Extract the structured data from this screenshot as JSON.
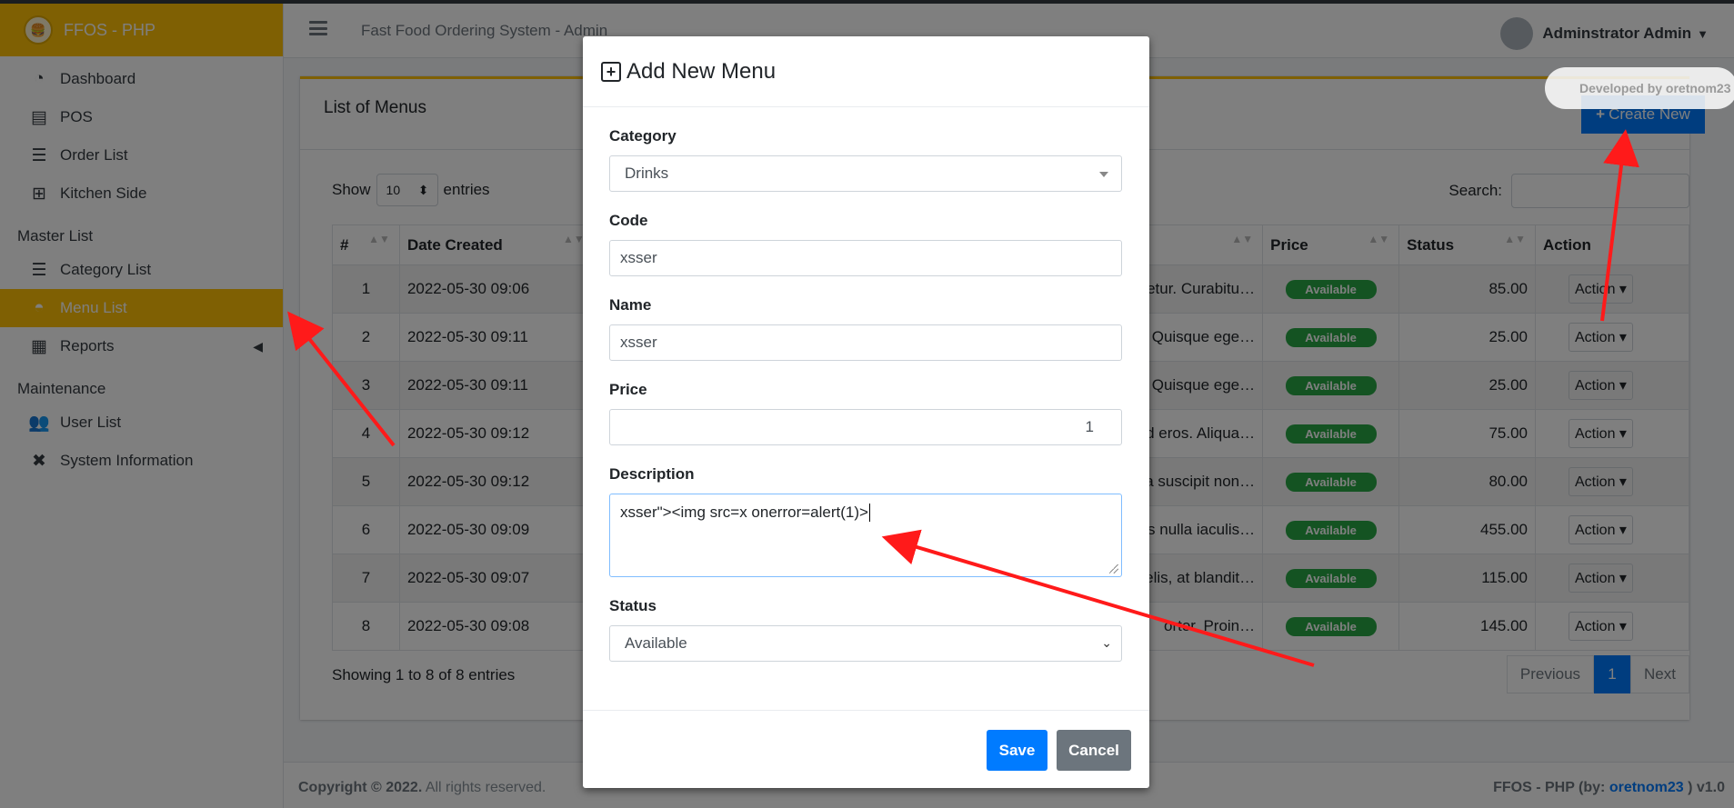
{
  "brand": {
    "name": "FFOS - PHP"
  },
  "sidebar": {
    "items": [
      {
        "label": "Dashboard",
        "icon": "tachometer-icon"
      },
      {
        "label": "POS",
        "icon": "cash-register-icon"
      },
      {
        "label": "Order List",
        "icon": "table-list-icon"
      },
      {
        "label": "Kitchen Side",
        "icon": "table-grid-icon"
      }
    ],
    "master_header": "Master List",
    "master_items": [
      {
        "label": "Category List",
        "icon": "table-list-icon"
      },
      {
        "label": "Menu List",
        "icon": "burger-icon",
        "active": true
      },
      {
        "label": "Reports",
        "icon": "file-icon"
      }
    ],
    "maintenance_header": "Maintenance",
    "maintenance_items": [
      {
        "label": "User List",
        "icon": "users-cog-icon"
      },
      {
        "label": "System Information",
        "icon": "tools-icon"
      }
    ]
  },
  "topbar": {
    "title": "Fast Food Ordering System - Admin",
    "user": "Adminstrator Admin"
  },
  "card": {
    "title": "List of Menus",
    "create_label": "Create New",
    "developer": "Developed by oretnom23",
    "show": "Show",
    "entries_value": "10",
    "entries": "entries",
    "search_label": "Search:",
    "showing": "Showing 1 to 8 of 8 entries",
    "pager": {
      "prev": "Previous",
      "current": "1",
      "next": "Next"
    }
  },
  "table": {
    "headers": [
      "#",
      "Date Created",
      "Price",
      "Status",
      "Action"
    ],
    "rows": [
      {
        "n": "1",
        "date": "2022-05-30 09:06",
        "desc": "ectetur. Curabitu…",
        "status": "Available",
        "price": "85.00",
        "action": "Action"
      },
      {
        "n": "2",
        "date": "2022-05-30 09:11",
        "desc": "tur. Quisque ege…",
        "status": "Available",
        "price": "25.00",
        "action": "Action"
      },
      {
        "n": "3",
        "date": "2022-05-30 09:11",
        "desc": "tur. Quisque ege…",
        "status": "Available",
        "price": "25.00",
        "action": "Action"
      },
      {
        "n": "4",
        "date": "2022-05-30 09:12",
        "desc": "n id eros. Aliqua…",
        "status": "Available",
        "price": "75.00",
        "action": "Action"
      },
      {
        "n": "5",
        "date": "2022-05-30 09:12",
        "desc": "a suscipit non…",
        "status": "Available",
        "price": "80.00",
        "action": "Action"
      },
      {
        "n": "6",
        "date": "2022-05-30 09:09",
        "desc": "us nulla iaculis…",
        "status": "Available",
        "price": "455.00",
        "action": "Action"
      },
      {
        "n": "7",
        "date": "2022-05-30 09:07",
        "desc": "felis, at blandit…",
        "status": "Available",
        "price": "115.00",
        "action": "Action"
      },
      {
        "n": "8",
        "date": "2022-05-30 09:08",
        "desc": "ortor. Proin…",
        "status": "Available",
        "price": "145.00",
        "action": "Action"
      }
    ]
  },
  "footer": {
    "copyright": "Copyright © 2022.",
    "rights": "All rights reserved.",
    "credit_prefix": "FFOS - PHP (by:",
    "credit_author": "oretnom23",
    "credit_suffix": ") v1.0"
  },
  "modal": {
    "title": "Add New Menu",
    "category_label": "Category",
    "category_value": "Drinks",
    "code_label": "Code",
    "code_value": "xsser",
    "name_label": "Name",
    "name_value": "xsser",
    "price_label": "Price",
    "price_value": "1",
    "description_label": "Description",
    "description_value": "xsser\"><img src=x onerror=alert(1)>",
    "status_label": "Status",
    "status_value": "Available",
    "save_label": "Save",
    "cancel_label": "Cancel"
  },
  "colors": {
    "brand": "#ffc107",
    "primary": "#007bff",
    "success": "#28a745",
    "secondary": "#6c757d",
    "annotation": "#ff1a1a"
  }
}
